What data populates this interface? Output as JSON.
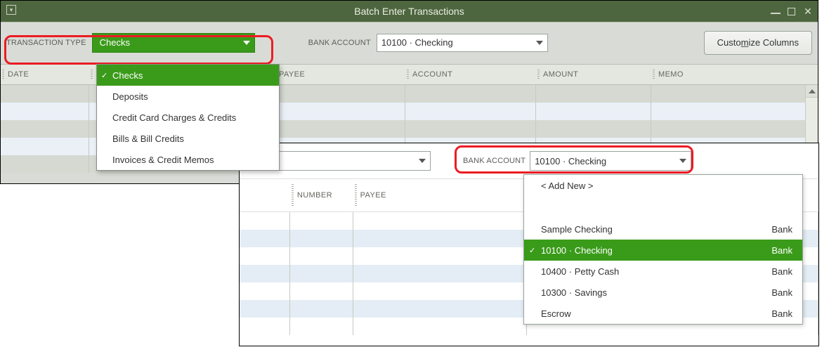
{
  "window": {
    "title": "Batch Enter Transactions"
  },
  "labels": {
    "transaction_type": "TRANSACTION TYPE",
    "bank_account": "BANK ACCOUNT",
    "customize": "Customize Columns"
  },
  "fields": {
    "tx_type_value": "Checks",
    "tx_type_value2": "Checks",
    "bank_account_value": "10100 · Checking",
    "bank_account_value2": "10100 · Checking"
  },
  "columns": {
    "date": "DATE",
    "number": "NUMBER",
    "payee": "PAYEE",
    "account": "ACCOUNT",
    "amount": "AMOUNT",
    "memo": "MEMO"
  },
  "tx_dropdown": {
    "0": {
      "label": "Checks",
      "selected": true
    },
    "1": {
      "label": "Deposits"
    },
    "2": {
      "label": "Credit Card Charges & Credits"
    },
    "3": {
      "label": "Bills & Bill Credits"
    },
    "4": {
      "label": "Invoices & Credit Memos"
    }
  },
  "acct_dropdown": {
    "add_new": "< Add New >",
    "0": {
      "name": "Sample Checking",
      "type": "Bank"
    },
    "1": {
      "name": "10100 · Checking",
      "type": "Bank",
      "selected": true
    },
    "2": {
      "name": "10400 · Petty Cash",
      "type": "Bank"
    },
    "3": {
      "name": "10300 · Savings",
      "type": "Bank"
    },
    "4": {
      "name": "Escrow",
      "type": "Bank"
    }
  }
}
